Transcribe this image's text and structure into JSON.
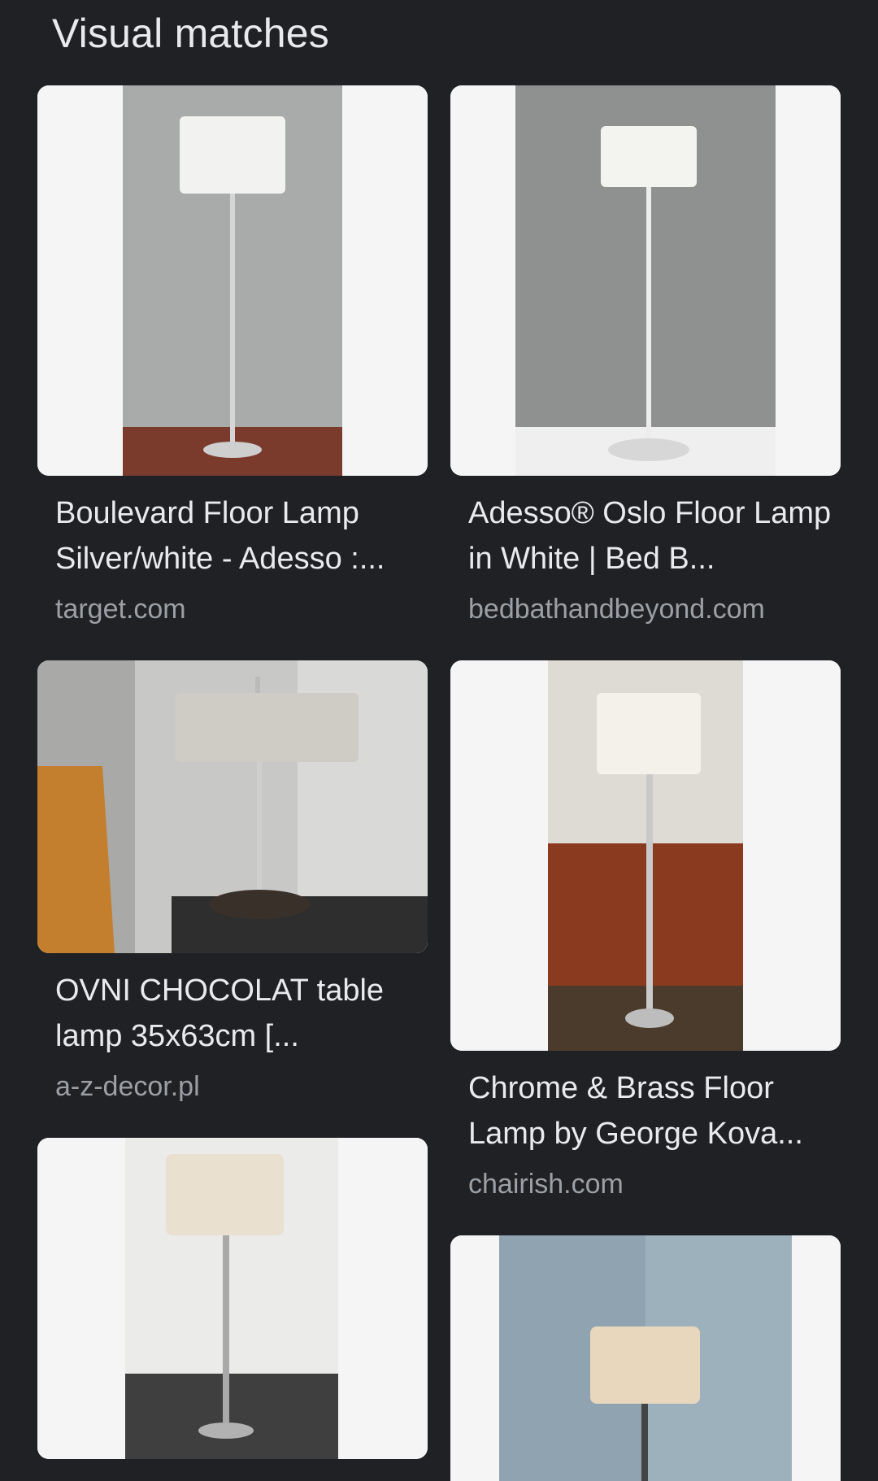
{
  "section": {
    "title": "Visual matches"
  },
  "results": [
    {
      "title": "Boulevard Floor Lamp Silver/white - Adesso :...",
      "source": "target.com",
      "image_icon": "floor-lamp-image"
    },
    {
      "title": "Adesso® Oslo Floor Lamp in White | Bed B...",
      "source": "bedbathandbeyond.com",
      "image_icon": "floor-lamp-image"
    },
    {
      "title": "OVNI CHOCOLAT table lamp 35x63cm [...",
      "source": "a-z-decor.pl",
      "image_icon": "table-lamp-image"
    },
    {
      "title": "Chrome & Brass Floor Lamp by George Kova...",
      "source": "chairish.com",
      "image_icon": "floor-lamp-image"
    },
    {
      "title": "",
      "source": "",
      "image_icon": "floor-lamp-image"
    },
    {
      "title": "",
      "source": "",
      "image_icon": "floor-lamp-image"
    }
  ]
}
